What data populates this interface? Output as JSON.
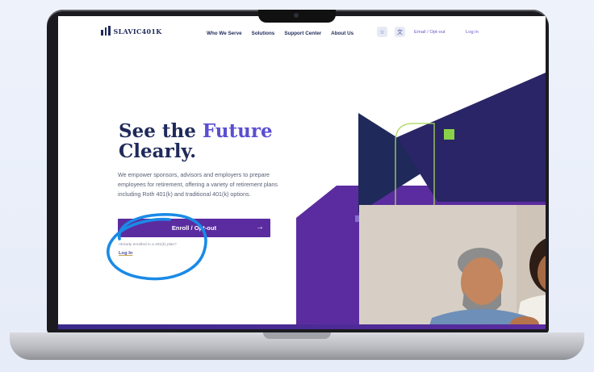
{
  "brand": {
    "name": "SLAVIC401K"
  },
  "nav": {
    "items": [
      "Who We Serve",
      "Solutions",
      "Support Center",
      "About Us"
    ],
    "email_optout": "Email / Opt-out",
    "login": "Log in",
    "icons": [
      "star-icon",
      "translate-icon"
    ]
  },
  "hero": {
    "title_line1_prefix": "See the ",
    "title_line1_accent": "Future",
    "title_line2": "Clearly.",
    "description": "We empower sponsors, advisors and employers to prepare employees for retirement, offering a variety of retirement plans including Roth 401(k) and traditional 401(k) options.",
    "cta_label": "Enroll / Opt-out",
    "cta_arrow": "→",
    "enrolled_note": "Already enrolled in a 401(k) plan?",
    "enrolled_login": "Log In"
  },
  "colors": {
    "navy": "#1f2a5a",
    "purple": "#5b2ca0",
    "accent": "#5a4fd0",
    "annotation": "#1a8ae6"
  }
}
